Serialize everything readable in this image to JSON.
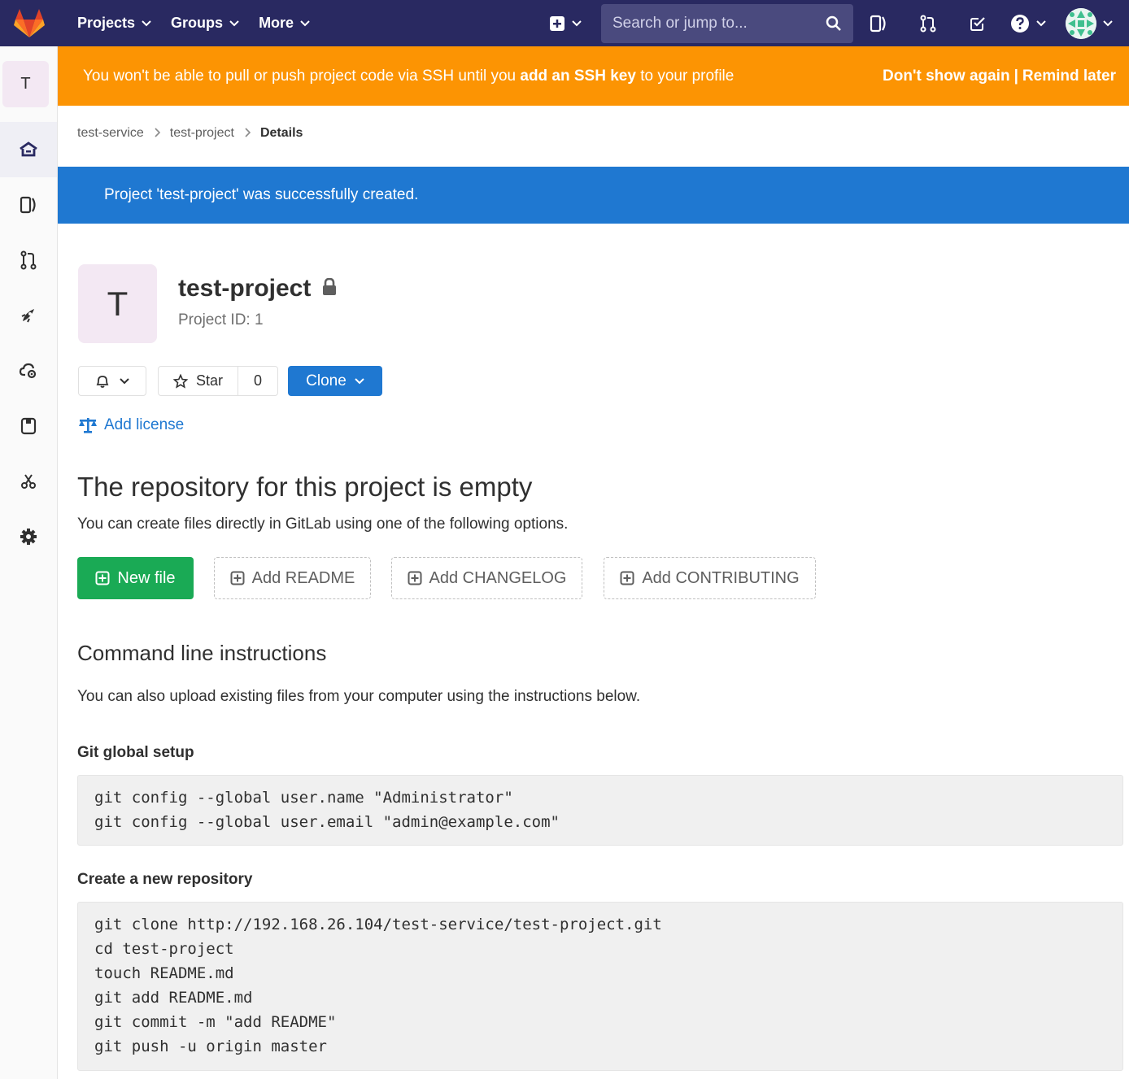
{
  "topnav": {
    "projects_label": "Projects",
    "groups_label": "Groups",
    "more_label": "More",
    "search_placeholder": "Search or jump to..."
  },
  "sidebar": {
    "project_initial": "T"
  },
  "ssh_alert": {
    "text_before": "You won't be able to pull or push project code via SSH until you ",
    "link": "add an SSH key",
    "text_after": " to your profile",
    "dont_show": "Don't show again",
    "separator": "|",
    "remind": "Remind later"
  },
  "breadcrumb": {
    "items": [
      "test-service",
      "test-project"
    ],
    "current": "Details"
  },
  "flash": {
    "message": "Project 'test-project' was successfully created."
  },
  "project": {
    "initial": "T",
    "name": "test-project",
    "id_text": "Project ID: 1",
    "star_label": "Star",
    "star_count": "0",
    "clone_label": "Clone",
    "add_license": "Add license"
  },
  "empty": {
    "title": "The repository for this project is empty",
    "description": "You can create files directly in GitLab using one of the following options.",
    "new_file": "New file",
    "add_readme": "Add README",
    "add_changelog": "Add CHANGELOG",
    "add_contributing": "Add CONTRIBUTING"
  },
  "cli": {
    "title": "Command line instructions",
    "description": "You can also upload existing files from your computer using the instructions below.",
    "global_setup_title": "Git global setup",
    "global_setup_lines": [
      "git config --global user.name \"Administrator\"",
      "git config --global user.email \"admin@example.com\""
    ],
    "new_repo_title": "Create a new repository",
    "new_repo_lines": [
      "git clone http://192.168.26.104/test-service/test-project.git",
      "cd test-project",
      "touch README.md",
      "git add README.md",
      "git commit -m \"add README\"",
      "git push -u origin master"
    ]
  },
  "colors": {
    "nav": "#292961",
    "alert": "#fc9403",
    "flash": "#1f78d1",
    "success": "#1aaa55"
  }
}
